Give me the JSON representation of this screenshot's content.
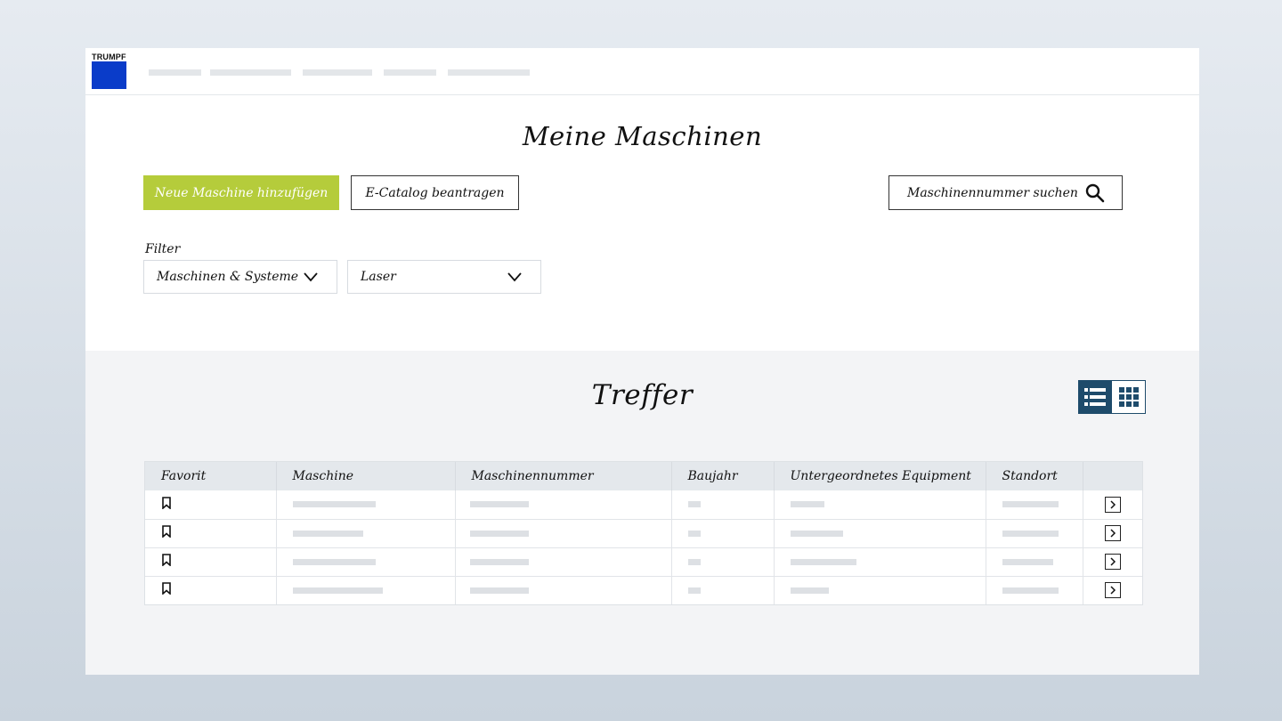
{
  "brand": {
    "name": "TRUMPF",
    "logo_color": "#0a3cc9"
  },
  "nav": {
    "items": [
      "",
      "",
      "",
      "",
      ""
    ]
  },
  "page": {
    "title": "Meine Maschinen"
  },
  "actions": {
    "primary_label": "Neue Maschine hinzufügen",
    "primary_color": "#b5cc3b",
    "secondary_label": "E-Catalog beantragen"
  },
  "search": {
    "placeholder": "Maschinennummer suchen",
    "icon": "search-icon"
  },
  "filter": {
    "label": "Filter",
    "selects": [
      {
        "value": "Maschinen & Systeme",
        "icon": "chevron-down-icon"
      },
      {
        "value": "Laser",
        "icon": "chevron-down-icon"
      }
    ]
  },
  "results": {
    "title": "Treffer",
    "view_modes": [
      "list-view-icon",
      "grid-view-icon"
    ],
    "active_view": "list",
    "accent": "#1e4b6b"
  },
  "table": {
    "columns": [
      "Favorit",
      "Maschine",
      "Maschinennummer",
      "Baujahr",
      "Untergeordnetes Equipment",
      "Standort",
      ""
    ],
    "rows": [
      {
        "favorite_icon": "bookmark-icon",
        "action_icon": "chevron-right-icon"
      },
      {
        "favorite_icon": "bookmark-icon",
        "action_icon": "chevron-right-icon"
      },
      {
        "favorite_icon": "bookmark-icon",
        "action_icon": "chevron-right-icon"
      },
      {
        "favorite_icon": "bookmark-icon",
        "action_icon": "chevron-right-icon"
      }
    ]
  }
}
